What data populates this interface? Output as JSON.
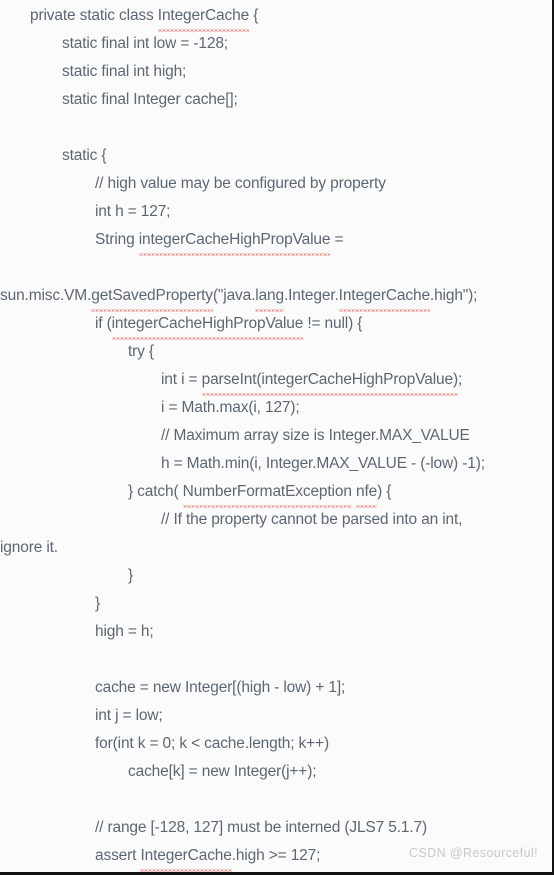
{
  "document": {
    "language": "java",
    "background_color": "#fbfbfb",
    "text_color": "#5d6772",
    "spellcheck_underline_color": "#e03a2f",
    "watermark_color": "#c9c9c9"
  },
  "watermark": {
    "text": "CSDN @Resourceful!"
  },
  "code": {
    "lines": [
      {
        "indent": 1,
        "text": "private static class IntegerCache {",
        "misspelled": [
          "IntegerCache"
        ]
      },
      {
        "indent": 2,
        "text": "static final int low = -128;",
        "misspelled": []
      },
      {
        "indent": 2,
        "text": "static final int high;",
        "misspelled": []
      },
      {
        "indent": 2,
        "text": "static final Integer cache[];",
        "misspelled": []
      },
      {
        "indent": 2,
        "text": "",
        "misspelled": []
      },
      {
        "indent": 2,
        "text": "static {",
        "misspelled": []
      },
      {
        "indent": 3,
        "text": "// high value may be configured by property",
        "misspelled": []
      },
      {
        "indent": 3,
        "text": "int h = 127;",
        "misspelled": []
      },
      {
        "indent": 3,
        "text": "String integerCacheHighPropValue =",
        "misspelled": [
          "integerCacheHighPropValue"
        ]
      },
      {
        "indent": 0,
        "text": "",
        "misspelled": []
      },
      {
        "indent": 0,
        "text": "sun.misc.VM.getSavedProperty(\"java.lang.Integer.IntegerCache.high\");",
        "misspelled": [
          "getSavedProperty",
          "lang",
          "IntegerCache"
        ]
      },
      {
        "indent": 3,
        "text": "if (integerCacheHighPropValue != null) {",
        "misspelled": [
          "integerCacheHighPropValue"
        ]
      },
      {
        "indent": 4,
        "text": "try {",
        "misspelled": []
      },
      {
        "indent": 5,
        "text": "int i = parseInt(integerCacheHighPropValue);",
        "misspelled": [
          "parseInt(integerCacheHighPropValue)"
        ]
      },
      {
        "indent": 5,
        "text": "i = Math.max(i, 127);",
        "misspelled": []
      },
      {
        "indent": 5,
        "text": "// Maximum array size is Integer.MAX_VALUE",
        "misspelled": []
      },
      {
        "indent": 5,
        "text": "h = Math.min(i, Integer.MAX_VALUE - (-low) -1);",
        "misspelled": []
      },
      {
        "indent": 4,
        "text": "} catch( NumberFormatException nfe) {",
        "misspelled": [
          "NumberFormatException",
          "nfe"
        ]
      },
      {
        "indent": 5,
        "text": "// If the property cannot be parsed into an int,",
        "misspelled": []
      },
      {
        "indent": 0,
        "text": "ignore it.",
        "misspelled": []
      },
      {
        "indent": 4,
        "text": "}",
        "misspelled": []
      },
      {
        "indent": 3,
        "text": "}",
        "misspelled": []
      },
      {
        "indent": 3,
        "text": "high = h;",
        "misspelled": []
      },
      {
        "indent": 3,
        "text": "",
        "misspelled": []
      },
      {
        "indent": 3,
        "text": "cache = new Integer[(high - low) + 1];",
        "misspelled": []
      },
      {
        "indent": 3,
        "text": "int j = low;",
        "misspelled": []
      },
      {
        "indent": 3,
        "text": "for(int k = 0; k < cache.length; k++)",
        "misspelled": []
      },
      {
        "indent": 4,
        "text": "cache[k] = new Integer(j++);",
        "misspelled": []
      },
      {
        "indent": 3,
        "text": "",
        "misspelled": []
      },
      {
        "indent": 3,
        "text": "// range [-128, 127] must be interned (JLS7 5.1.7)",
        "misspelled": []
      },
      {
        "indent": 3,
        "text": "assert IntegerCache.high >= 127;",
        "misspelled": [
          "IntegerCache"
        ]
      }
    ]
  }
}
